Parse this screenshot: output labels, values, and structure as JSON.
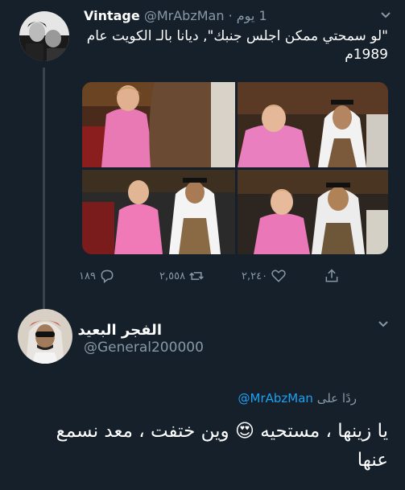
{
  "tweet": {
    "author_name": "Vintage",
    "author_handle": "@MrAbzMan",
    "separator": "·",
    "time": "1 يوم",
    "text": "\"لو سمحتي ممكن اجلس جنبك\", ديانا بالـ الكويت عام 1989م",
    "replies_count": "١٨٩",
    "retweets_count": "٢,٥٥٨",
    "likes_count": "٢,٢٤٠"
  },
  "reply": {
    "author_name": "الفجر البعيد",
    "author_handle": "@General200000",
    "replying_to_prefix": "ردًا على",
    "replying_to_handle": "@MrAbzMan",
    "text_part1": "يا زينها ، مستحيه",
    "emoji": "😍",
    "text_part2": "وين ختفت ، معد نسمع عنها"
  },
  "colors": {
    "background": "#15202b",
    "secondary_text": "#8899a6",
    "link": "#1da1f2",
    "thread_line": "#38444d"
  },
  "icons": {
    "reply": "reply-icon",
    "retweet": "retweet-icon",
    "like": "heart-icon",
    "share": "share-icon",
    "menu": "chevron-down-icon"
  }
}
